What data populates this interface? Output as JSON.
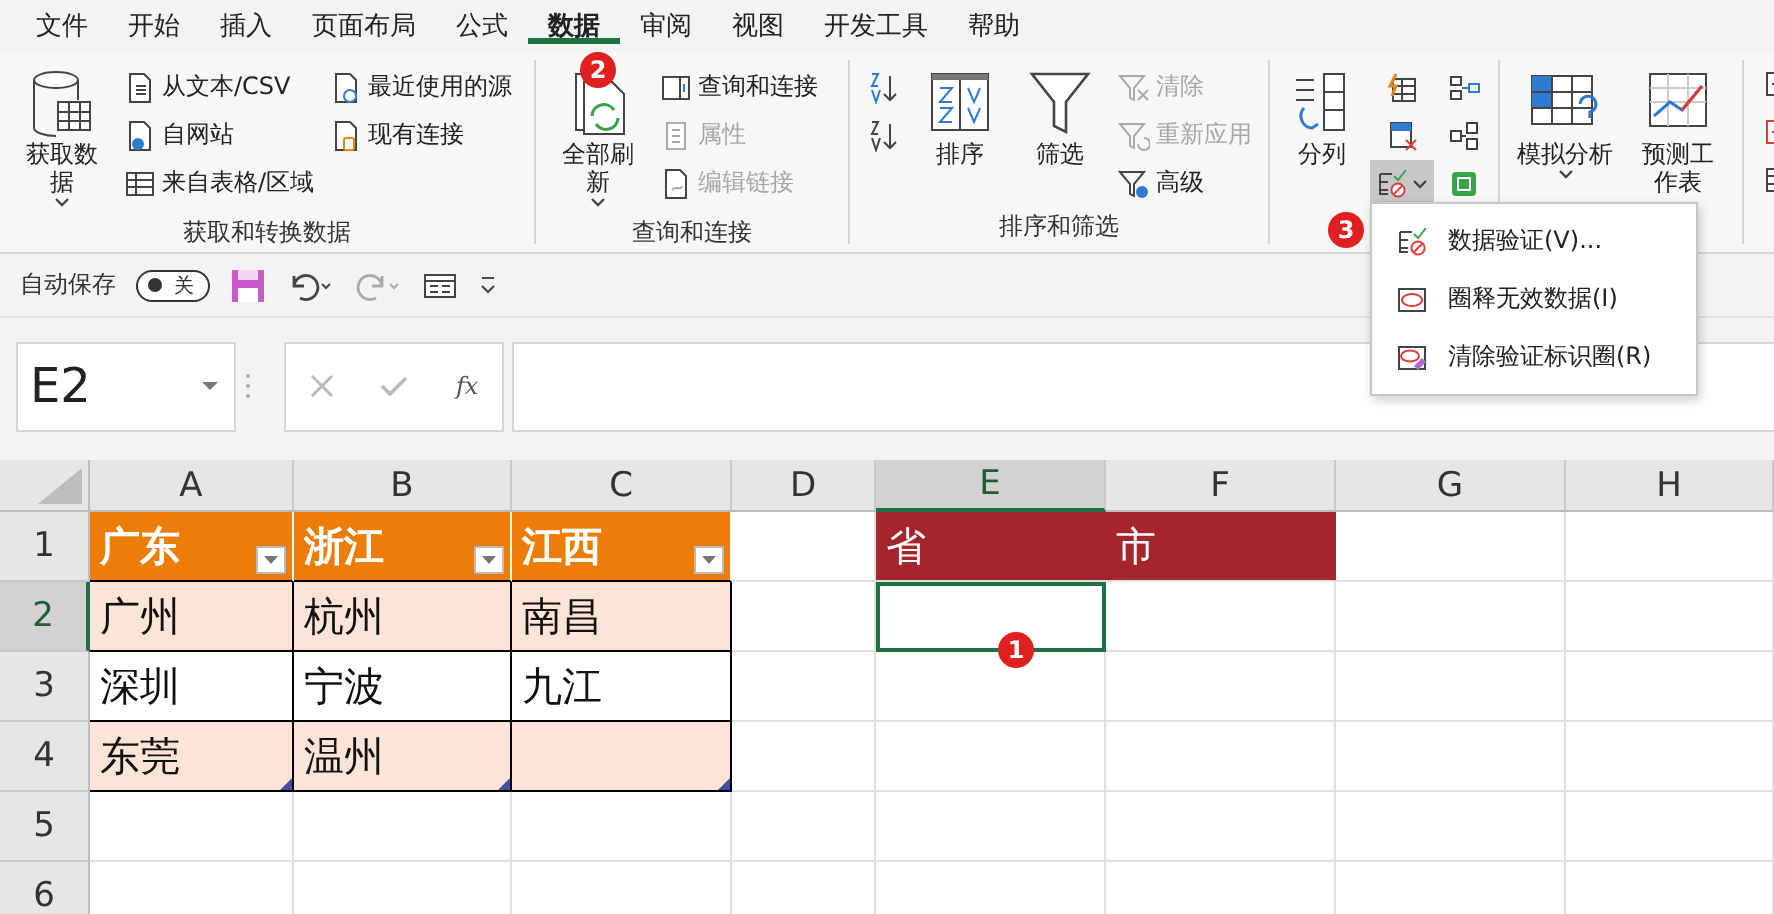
{
  "tabs": [
    {
      "label": "文件",
      "selected": false
    },
    {
      "label": "开始",
      "selected": false
    },
    {
      "label": "插入",
      "selected": false
    },
    {
      "label": "页面布局",
      "selected": false
    },
    {
      "label": "公式",
      "selected": false
    },
    {
      "label": "数据",
      "selected": true
    },
    {
      "label": "审阅",
      "selected": false
    },
    {
      "label": "视图",
      "selected": false
    },
    {
      "label": "开发工具",
      "selected": false
    },
    {
      "label": "帮助",
      "selected": false
    }
  ],
  "ribbon": {
    "groups": [
      {
        "label": "获取和转换数据",
        "items": [
          {
            "label": "获取数据",
            "kind": "large",
            "caret": true,
            "disabled": false
          },
          {
            "label": "从文本/CSV",
            "kind": "small",
            "disabled": false
          },
          {
            "label": "自网站",
            "kind": "small",
            "disabled": false
          },
          {
            "label": "来自表格/区域",
            "kind": "small",
            "disabled": false
          },
          {
            "label": "最近使用的源",
            "kind": "small",
            "disabled": false
          },
          {
            "label": "现有连接",
            "kind": "small",
            "disabled": false
          }
        ]
      },
      {
        "label": "查询和连接",
        "items": [
          {
            "label": "全部刷新",
            "kind": "large",
            "caret": true,
            "disabled": false
          },
          {
            "label": "查询和连接",
            "kind": "small",
            "disabled": false
          },
          {
            "label": "属性",
            "kind": "small",
            "disabled": true
          },
          {
            "label": "编辑链接",
            "kind": "small",
            "disabled": true
          }
        ]
      },
      {
        "label": "排序和筛选",
        "items": [
          {
            "label": "排序",
            "kind": "large",
            "caret": false,
            "disabled": false
          },
          {
            "label": "筛选",
            "kind": "large",
            "caret": false,
            "disabled": false
          },
          {
            "label": "清除",
            "kind": "small",
            "disabled": true
          },
          {
            "label": "重新应用",
            "kind": "small",
            "disabled": true
          },
          {
            "label": "高级",
            "kind": "small",
            "disabled": false
          }
        ]
      },
      {
        "items": [
          {
            "label": "分列",
            "kind": "large",
            "caret": false,
            "disabled": false
          }
        ],
        "data_validation_button": {
          "expanded": true
        }
      },
      {
        "items": [
          {
            "label": "模拟分析",
            "kind": "large",
            "caret": true,
            "disabled": false
          },
          {
            "label": "预测工作表",
            "kind": "large",
            "caret": false,
            "disabled": false
          }
        ]
      }
    ]
  },
  "quick_access": {
    "autosave_label": "自动保存",
    "autosave_toggle": {
      "text": "关",
      "on": false
    }
  },
  "formula_bar": {
    "name_box": "E2",
    "fx": "fx"
  },
  "menu": {
    "items": [
      {
        "label": "数据验证(V)..."
      },
      {
        "label": "圈释无效数据(I)"
      },
      {
        "label": "清除验证标识圈(R)"
      }
    ]
  },
  "sheet": {
    "columns": [
      {
        "label": "A",
        "selected": false
      },
      {
        "label": "B",
        "selected": false
      },
      {
        "label": "C",
        "selected": false
      },
      {
        "label": "D",
        "selected": false
      },
      {
        "label": "E",
        "selected": true
      },
      {
        "label": "F",
        "selected": false
      },
      {
        "label": "G",
        "selected": false
      },
      {
        "label": "H",
        "selected": false
      }
    ],
    "rows": [
      {
        "label": "1",
        "selected": false,
        "cells": [
          {
            "text": "广东",
            "kind": "table_header"
          },
          {
            "text": "浙江",
            "kind": "table_header"
          },
          {
            "text": "江西",
            "kind": "table_header"
          },
          {
            "kind": "empty"
          },
          {
            "text": "省",
            "kind": "title"
          },
          {
            "text": "市",
            "kind": "title"
          },
          {
            "kind": "empty"
          },
          {
            "kind": "empty"
          }
        ]
      },
      {
        "label": "2",
        "selected": true,
        "cells": [
          {
            "text": "广州",
            "kind": "band"
          },
          {
            "text": "杭州",
            "kind": "band"
          },
          {
            "text": "南昌",
            "kind": "band"
          },
          {
            "kind": "empty"
          },
          {
            "kind": "active"
          },
          {
            "kind": "empty"
          },
          {
            "kind": "empty"
          },
          {
            "kind": "empty"
          }
        ]
      },
      {
        "label": "3",
        "selected": false,
        "cells": [
          {
            "text": "深圳",
            "kind": "plain"
          },
          {
            "text": "宁波",
            "kind": "plain"
          },
          {
            "text": "九江",
            "kind": "plain"
          },
          {
            "kind": "empty"
          },
          {
            "kind": "empty"
          },
          {
            "kind": "empty"
          },
          {
            "kind": "empty"
          },
          {
            "kind": "empty"
          }
        ]
      },
      {
        "label": "4",
        "selected": false,
        "cells": [
          {
            "text": "东莞",
            "kind": "band_last"
          },
          {
            "text": "温州",
            "kind": "band_last"
          },
          {
            "kind": "band_last"
          },
          {
            "kind": "empty"
          },
          {
            "kind": "empty"
          },
          {
            "kind": "empty"
          },
          {
            "kind": "empty"
          },
          {
            "kind": "empty"
          }
        ]
      },
      {
        "label": "5",
        "selected": false,
        "cells": [
          {
            "kind": "empty"
          },
          {
            "kind": "empty"
          },
          {
            "kind": "empty"
          },
          {
            "kind": "empty"
          },
          {
            "kind": "empty"
          },
          {
            "kind": "empty"
          },
          {
            "kind": "empty"
          },
          {
            "kind": "empty"
          }
        ]
      },
      {
        "label": "6",
        "selected": false,
        "cells": [
          {
            "kind": "empty"
          },
          {
            "kind": "empty"
          },
          {
            "kind": "empty"
          },
          {
            "kind": "empty"
          },
          {
            "kind": "empty"
          },
          {
            "kind": "empty"
          },
          {
            "kind": "empty"
          },
          {
            "kind": "empty"
          }
        ]
      }
    ]
  },
  "callouts": [
    {
      "number": "1"
    },
    {
      "number": "2"
    },
    {
      "number": "3"
    }
  ]
}
